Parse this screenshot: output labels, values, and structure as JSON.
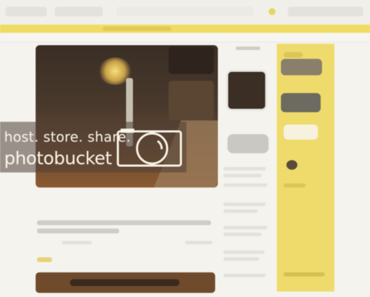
{
  "watermark": {
    "line1": "host. store. share.",
    "line2": "photobucket"
  },
  "icons": {
    "camera": "camera-icon"
  },
  "colors": {
    "accent_yellow": "#efdb6b",
    "hero_dark": "#3a2e25",
    "watermark_text": "#fbf5ea"
  }
}
